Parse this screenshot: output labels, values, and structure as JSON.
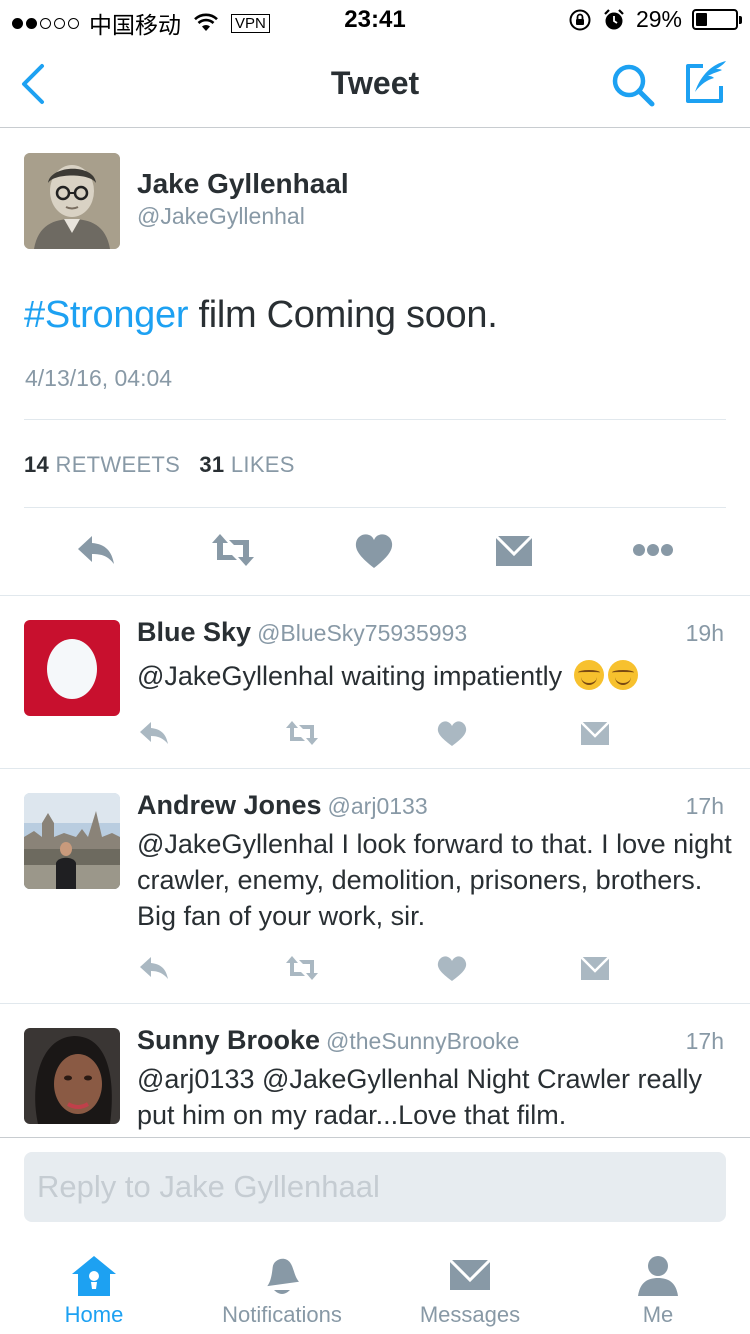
{
  "status_bar": {
    "carrier": "中国移动",
    "vpn": "VPN",
    "time": "23:41",
    "battery": "29%"
  },
  "nav": {
    "title": "Tweet",
    "back_icon": "chevron-left-icon",
    "search_icon": "search-icon",
    "compose_icon": "compose-icon"
  },
  "tweet": {
    "name": "Jake Gyllenhaal",
    "handle": "@JakeGyllenhal",
    "hashtag": "#Stronger",
    "text": " film Coming soon.",
    "timestamp": "4/13/16, 04:04",
    "retweets_count": "14",
    "retweets_label": "RETWEETS",
    "likes_count": "31",
    "likes_label": "LIKES"
  },
  "replies": [
    {
      "name": "Blue Sky",
      "handle": "@BlueSky75935993",
      "time": "19h",
      "text": "@JakeGyllenhal waiting impatiently"
    },
    {
      "name": "Andrew Jones",
      "handle": "@arj0133",
      "time": "17h",
      "text": "@JakeGyllenhal  I look forward to that. I love night crawler, enemy, demolition, prisoners, brothers. Big fan of your work, sir."
    },
    {
      "name": "Sunny Brooke",
      "handle": "@theSunnyBrooke",
      "time": "17h",
      "text": "@arj0133 @JakeGyllenhal Night Crawler really put him on my radar...Love that film."
    }
  ],
  "composer": {
    "placeholder": "Reply to Jake Gyllenhaal"
  },
  "tabs": [
    {
      "label": "Home",
      "icon": "home-icon"
    },
    {
      "label": "Notifications",
      "icon": "bell-icon"
    },
    {
      "label": "Messages",
      "icon": "envelope-icon"
    },
    {
      "label": "Me",
      "icon": "person-icon"
    }
  ],
  "colors": {
    "accent": "#1da1f2",
    "muted": "#8899a6",
    "icon_gray": "#8899a6",
    "reply_icon_gray": "#aab8c2"
  }
}
